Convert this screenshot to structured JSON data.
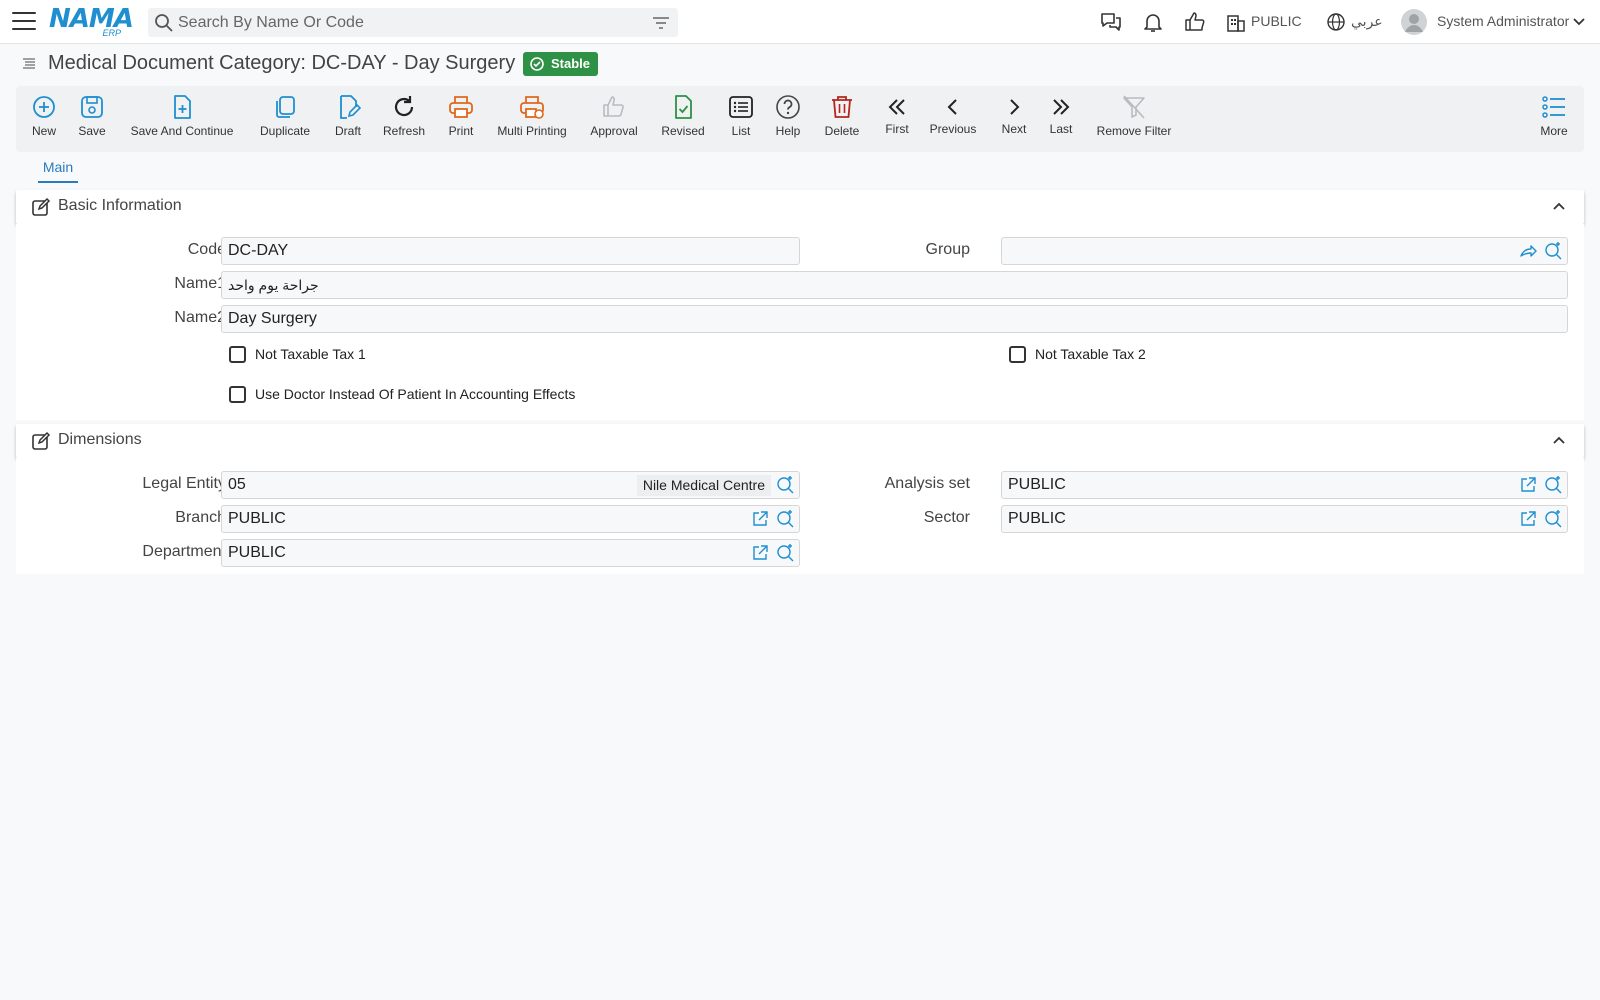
{
  "app": {
    "logo_main": "NAMA",
    "logo_sub": "ERP",
    "search_placeholder": "Search By Name Or Code",
    "company_label": "PUBLIC",
    "language_label": "عربي",
    "user_name": "System Administrator"
  },
  "page": {
    "title": "Medical Document Category: DC-DAY - Day Surgery",
    "status_badge": "Stable"
  },
  "toolbar": {
    "new": "New",
    "save": "Save",
    "save_continue": "Save And Continue",
    "duplicate": "Duplicate",
    "draft": "Draft",
    "refresh": "Refresh",
    "print": "Print",
    "multi_printing": "Multi Printing",
    "approval": "Approval",
    "revised": "Revised",
    "list": "List",
    "help": "Help",
    "delete": "Delete",
    "first": "First",
    "previous": "Previous",
    "next": "Next",
    "last": "Last",
    "remove_filter": "Remove Filter",
    "more": "More"
  },
  "tabs": {
    "main": "Main"
  },
  "basic": {
    "title": "Basic Information",
    "code_label": "Code",
    "code_value": "DC-DAY",
    "group_label": "Group",
    "group_value": "",
    "name1_label": "Name1",
    "name1_value": "جراحة يوم واحد",
    "name2_label": "Name2",
    "name2_value": "Day Surgery",
    "not_taxable_1": "Not Taxable Tax 1",
    "not_taxable_2": "Not Taxable Tax 2",
    "use_doctor": "Use Doctor Instead Of Patient In Accounting Effects"
  },
  "dimensions": {
    "title": "Dimensions",
    "legal_entity_label": "Legal Entity",
    "legal_entity_code": "05",
    "legal_entity_name": "Nile Medical Centre",
    "analysis_set_label": "Analysis set",
    "analysis_set_value": "PUBLIC",
    "branch_label": "Branch",
    "branch_value": "PUBLIC",
    "sector_label": "Sector",
    "sector_value": "PUBLIC",
    "department_label": "Department",
    "department_value": "PUBLIC"
  },
  "colors": {
    "accent_blue": "#1f8fd1",
    "badge_green": "#2e9145",
    "print_orange": "#e0681d",
    "delete_red": "#b3261e"
  }
}
